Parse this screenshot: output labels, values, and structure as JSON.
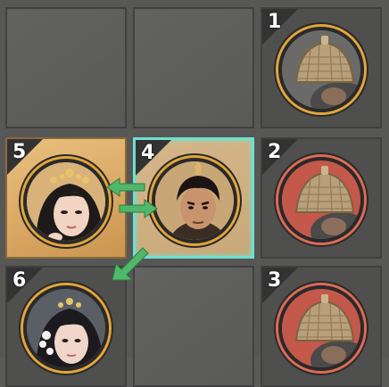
{
  "board": {
    "cells": [
      {
        "id": "r0c0",
        "state": "empty"
      },
      {
        "id": "r0c1",
        "state": "empty"
      },
      {
        "id": "r0c2",
        "state": "occupied",
        "unit": {
          "number": "1",
          "portrait": "helmeted-soldier",
          "side": "ally",
          "ring_color": "#e3a63a"
        }
      },
      {
        "id": "r1c0",
        "state": "occupied",
        "unit": {
          "number": "5",
          "portrait": "noblewoman-with-crown",
          "side": "ally",
          "ring_color": "#e3a63a"
        }
      },
      {
        "id": "r1c1",
        "state": "occupied",
        "unit": {
          "number": "4",
          "portrait": "male-warrior",
          "side": "ally",
          "ring_color": "#e3a63a"
        }
      },
      {
        "id": "r1c2",
        "state": "occupied",
        "unit": {
          "number": "2",
          "portrait": "helmeted-soldier",
          "side": "enemy",
          "ring_color": "#e06a55"
        }
      },
      {
        "id": "r2c0",
        "state": "occupied",
        "unit": {
          "number": "6",
          "portrait": "noblewoman-with-flowers",
          "side": "ally",
          "ring_color": "#e3a63a"
        }
      },
      {
        "id": "r2c1",
        "state": "empty"
      },
      {
        "id": "r2c2",
        "state": "occupied",
        "unit": {
          "number": "3",
          "portrait": "helmeted-soldier",
          "side": "enemy",
          "ring_color": "#e06a55"
        }
      }
    ],
    "selected_unit": "4",
    "highlighted_units": [
      "5",
      "4"
    ],
    "colors": {
      "selection_border": "#6fe0d0",
      "arrow": "#4fb86a",
      "ally_ring": "#e3a63a",
      "enemy_ring": "#e06a55",
      "highlight_tile": "#e0b26e"
    }
  }
}
